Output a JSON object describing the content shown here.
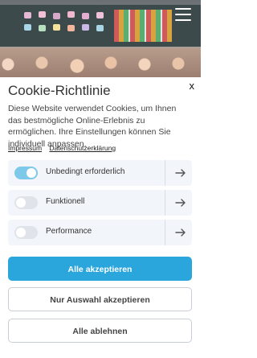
{
  "header": {
    "menu_icon": "hamburger-menu-icon"
  },
  "cookie_banner": {
    "title": "Cookie-Richtlinie",
    "close_label": "x",
    "description": "Diese Website verwendet Cookies, um Ihnen das bestmögliche Online-Erlebnis zu ermöglichen. Ihre Einstellungen können Sie individuell anpassen.",
    "links": {
      "imprint": "Impressum",
      "privacy": "Datenschutzerklärung"
    },
    "categories": [
      {
        "label": "Unbedingt erforderlich",
        "enabled": true
      },
      {
        "label": "Funktionell",
        "enabled": false
      },
      {
        "label": "Performance",
        "enabled": false
      }
    ],
    "buttons": {
      "accept_all": "Alle akzeptieren",
      "accept_selection": "Nur Auswahl akzeptieren",
      "reject_all": "Alle ablehnen"
    },
    "colors": {
      "accent": "#2aa6dd",
      "toggle_on": "#7ec9ea",
      "toggle_off": "#e0e4ea",
      "row_bg": "#f2f5fa"
    },
    "arrow_icon": "arrow-right-icon"
  }
}
